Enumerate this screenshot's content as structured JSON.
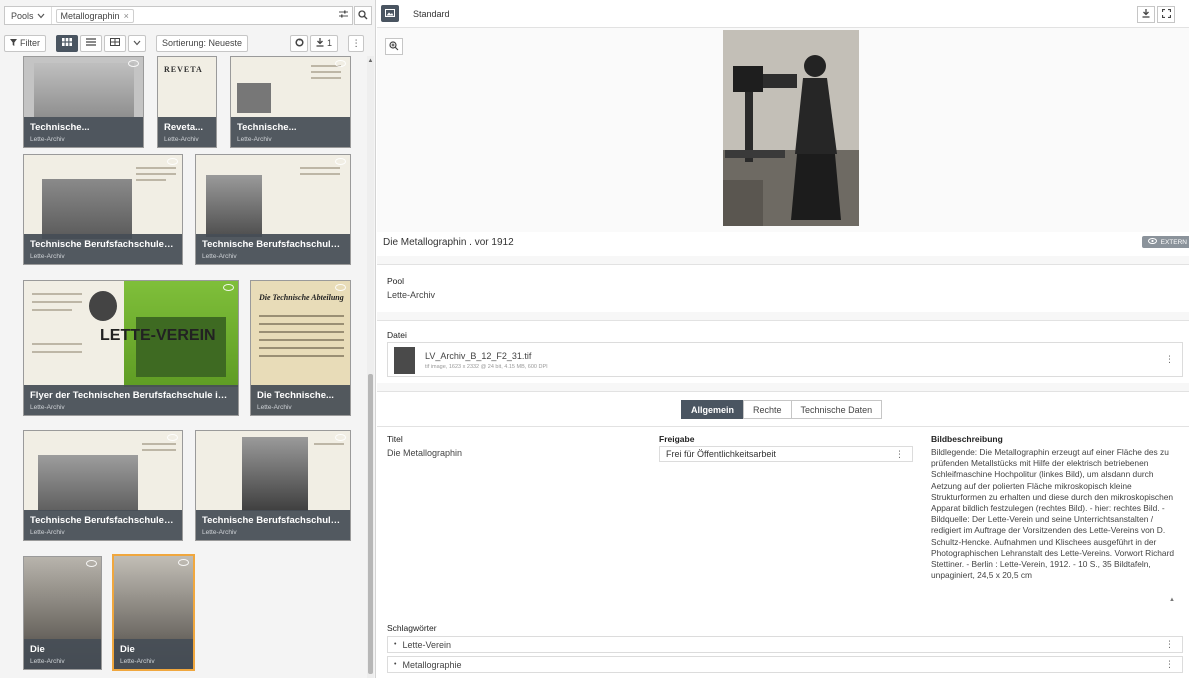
{
  "search": {
    "pools_label": "Pools",
    "chip_label": "Metallographin",
    "chip_close": "×",
    "filter_icon": "sliders-icon",
    "search_icon": "magnifier-icon"
  },
  "toolbar": {
    "filter_label": "Filter",
    "sort_label": "Sortierung: Neueste",
    "download_count": "1",
    "more": "⋮"
  },
  "results": [
    {
      "title": "Technische...",
      "pool": "Lette-Archiv"
    },
    {
      "title": "Reveta...",
      "pool": "Lette-Archiv"
    },
    {
      "title": "Technische...",
      "pool": "Lette-Archiv"
    },
    {
      "title": "Technische Berufsfachschule im...",
      "pool": "Lette-Archiv"
    },
    {
      "title": "Technische Berufsfachschule im...",
      "pool": "Lette-Archiv"
    },
    {
      "title": "Flyer der Technischen Berufsfachschule im Lett...",
      "pool": "Lette-Archiv"
    },
    {
      "title": "Die Technische...",
      "pool": "Lette-Archiv"
    },
    {
      "title": "Technische Berufsfachschule im...",
      "pool": "Lette-Archiv"
    },
    {
      "title": "Technische Berufsfachschule im...",
      "pool": "Lette-Archiv"
    },
    {
      "title": "Die",
      "pool": "Lette-Archiv"
    },
    {
      "title": "Die",
      "pool": "Lette-Archiv"
    }
  ],
  "thumb_texts": {
    "reveta": "REVETA",
    "lette_verein": "LETTE-VEREIN",
    "die_technische": "Die Technische Abteilung"
  },
  "detail": {
    "view_label": "Standard",
    "object_title": "Die Metallographin . vor 1912",
    "external_badge": "EXTERN",
    "pool_label": "Pool",
    "pool_value": "Lette-Archiv",
    "file_label": "Datei",
    "file_name": "LV_Archiv_B_12_F2_31.tif",
    "file_meta": "tif image, 1623 x 2332 @ 24 bit, 4.15 MB, 600 DPI",
    "tabs": [
      "Allgemein",
      "Rechte",
      "Technische Daten"
    ],
    "titel_label": "Titel",
    "titel_value": "Die Metallographin",
    "freigabe_label": "Freigabe",
    "freigabe_value": "Frei für Öffentlichkeitsarbeit",
    "beschreibung_label": "Bildbeschreibung",
    "beschreibung_value": "Bildlegende: Die Metallographin erzeugt auf einer Fläche des zu prüfenden Metallstücks mit Hilfe der elektrisch betriebenen Schleifmaschine Hochpolitur (linkes Bild), um alsdann durch Aetzung auf der polierten Fläche mikroskopisch kleine Strukturformen zu erhalten und diese durch den mikroskopischen Apparat bildlich festzulegen (rechtes Bild). - hier: rechtes Bild. - Bildquelle: Der Lette-Verein und seine Unterrichtsanstalten / redigiert im Auftrage der Vorsitzenden des Lette-Vereins von D. Schultz-Hencke. Aufnahmen und Klischees ausgeführt in der Photographischen Lehranstalt des Lette-Vereins. Vorwort Richard Stettiner. - Berlin : Lette-Verein, 1912. - 10 S., 35 Bildtafeln, unpaginiert, 24,5 x 20,5 cm",
    "schlagwoerter_label": "Schlagwörter",
    "keywords": [
      "Lette-Verein",
      "Metallographie"
    ]
  },
  "colors": {
    "accent_dark": "#4a5561",
    "selection": "#f0a73e"
  }
}
